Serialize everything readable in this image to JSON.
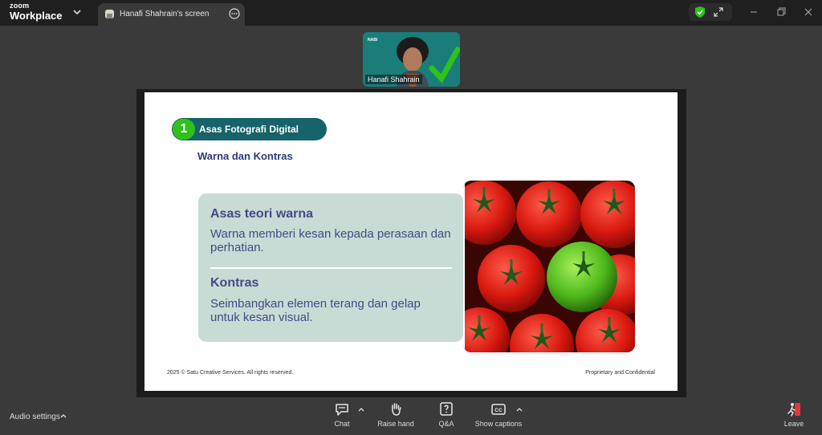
{
  "titlebar": {
    "brand_line1": "zoom",
    "brand_line2": "Workplace",
    "tab_title": "Hanafi Shahrain's screen"
  },
  "participant": {
    "name": "Hanafi Shahrain",
    "logo_text": "NABI"
  },
  "slide": {
    "section_number": "1",
    "section_title": "Asas Fotografi Digital",
    "subtitle": "Warna dan Kontras",
    "block1_heading": "Asas teori warna",
    "block1_text": "Warna memberi kesan kepada perasaan dan perhatian.",
    "block2_heading": "Kontras",
    "block2_text": "Seimbangkan elemen terang dan gelap untuk kesan visual.",
    "footer_left": "2025 © Satu Creative Services. All rights reserved.",
    "footer_right": "Proprietary and Confidential"
  },
  "toolbar": {
    "audio_settings": "Audio settings",
    "chat": "Chat",
    "raise_hand": "Raise hand",
    "qa": "Q&A",
    "show_captions": "Show captions",
    "leave": "Leave"
  },
  "colors": {
    "accent_green": "#2ec21a",
    "section_teal": "#16636b",
    "heading_navy": "#2c3a7a",
    "card_bg": "#c9dbd5",
    "card_text": "#444a86",
    "leave_red": "#e5383b"
  },
  "icons": {
    "chat": "chat-bubble-icon",
    "raise_hand": "hand-icon",
    "qa": "question-box-icon",
    "captions": "cc-icon",
    "leave": "leave-person-icon",
    "security": "shield-check-icon"
  }
}
